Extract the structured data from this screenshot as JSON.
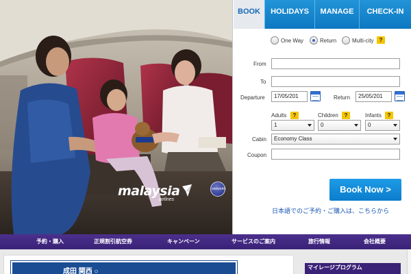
{
  "tabs": [
    {
      "label": "BOOK",
      "active": true
    },
    {
      "label": "HOLIDAYS",
      "active": false
    },
    {
      "label": "MANAGE",
      "active": false
    },
    {
      "label": "CHECK-IN",
      "active": false
    }
  ],
  "trip_types": {
    "one_way": "One Way",
    "return": "Return",
    "multi_city": "Multi-city",
    "selected": "Return"
  },
  "form": {
    "from_label": "From",
    "from_value": "",
    "to_label": "To",
    "to_value": "",
    "departure_label": "Departure",
    "departure_value": "17/05/201",
    "return_label": "Return",
    "return_value": "25/05/201",
    "adults_label": "Adults",
    "adults_value": "1",
    "children_label": "Children",
    "children_value": "0",
    "infants_label": "Infants",
    "infants_value": "0",
    "cabin_label": "Cabin",
    "cabin_value": "Economy Class",
    "coupon_label": "Coupon",
    "coupon_value": "",
    "help_glyph": "?"
  },
  "book_button": "Book Now >",
  "japanese_link": "日本語でのご予約・ご購入は、こちらから",
  "hero": {
    "brand": "malaysia",
    "brand_sub": "airlines",
    "alliance": "oneworld"
  },
  "nav": [
    "予約・購入",
    "正規割引航空券",
    "キャンペーン",
    "サービスのご案内",
    "旅行情報",
    "会社概要"
  ],
  "bottom": {
    "promo_text": "成田 関西 ○",
    "mileage_label": "マイレージプログラム"
  },
  "colors": {
    "tab_blue": "#1588d0",
    "nav_purple": "#3a2277",
    "button_blue": "#1590de",
    "help_yellow": "#f5c400"
  }
}
